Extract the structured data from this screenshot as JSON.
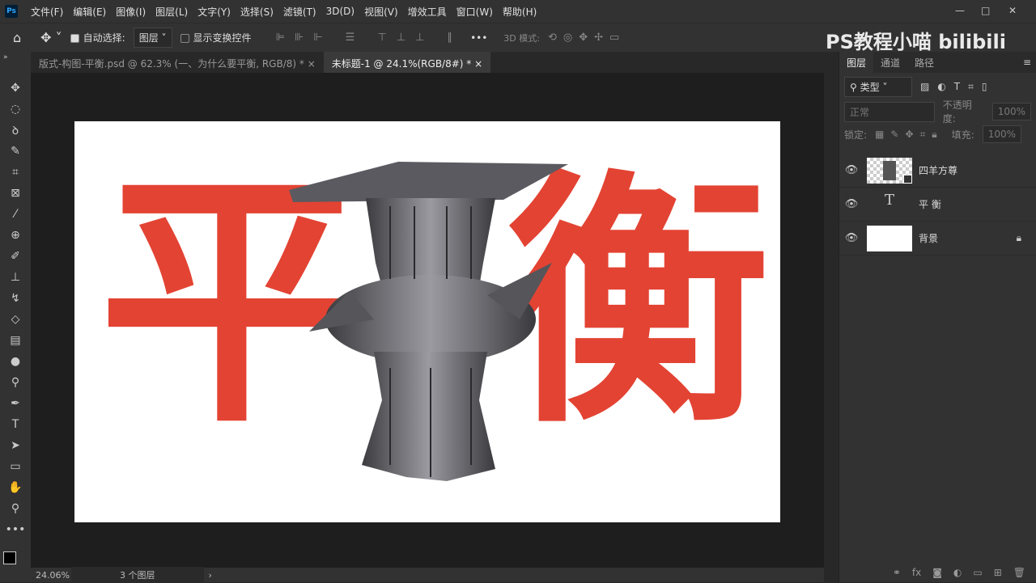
{
  "menu": [
    "文件(F)",
    "编辑(E)",
    "图像(I)",
    "图层(L)",
    "文字(Y)",
    "选择(S)",
    "滤镜(T)",
    "3D(D)",
    "视图(V)",
    "增效工具",
    "窗口(W)",
    "帮助(H)"
  ],
  "app_logo": "Ps",
  "options": {
    "auto_select_label": "自动选择:",
    "auto_select_value": "图层",
    "show_transform_label": "显示变换控件",
    "mode_3d_label": "3D 模式:",
    "more": "•••"
  },
  "watermark": "PS教程小喵 bilibili",
  "tabs": [
    {
      "label": "版式-构图-平衡.psd @ 62.3% (一、为什么要平衡, RGB/8) *",
      "active": false
    },
    {
      "label": "未标题-1 @ 24.1%(RGB/8#) *",
      "active": true
    }
  ],
  "canvas": {
    "char_left": "平",
    "char_right": "衡",
    "red": "#e34333"
  },
  "status": {
    "zoom": "24.06%",
    "info": "3 个图层"
  },
  "panel": {
    "tabs": [
      "图层",
      "通道",
      "路径"
    ],
    "filter": "类型",
    "blend": "正常",
    "opacity_label": "不透明度:",
    "opacity": "100%",
    "lock_label": "锁定:",
    "fill_label": "填充:",
    "fill": "100%",
    "layers": [
      {
        "name": "四羊方尊",
        "type": "smart"
      },
      {
        "name": "平 衡",
        "type": "text"
      },
      {
        "name": "背景",
        "type": "background"
      }
    ]
  }
}
